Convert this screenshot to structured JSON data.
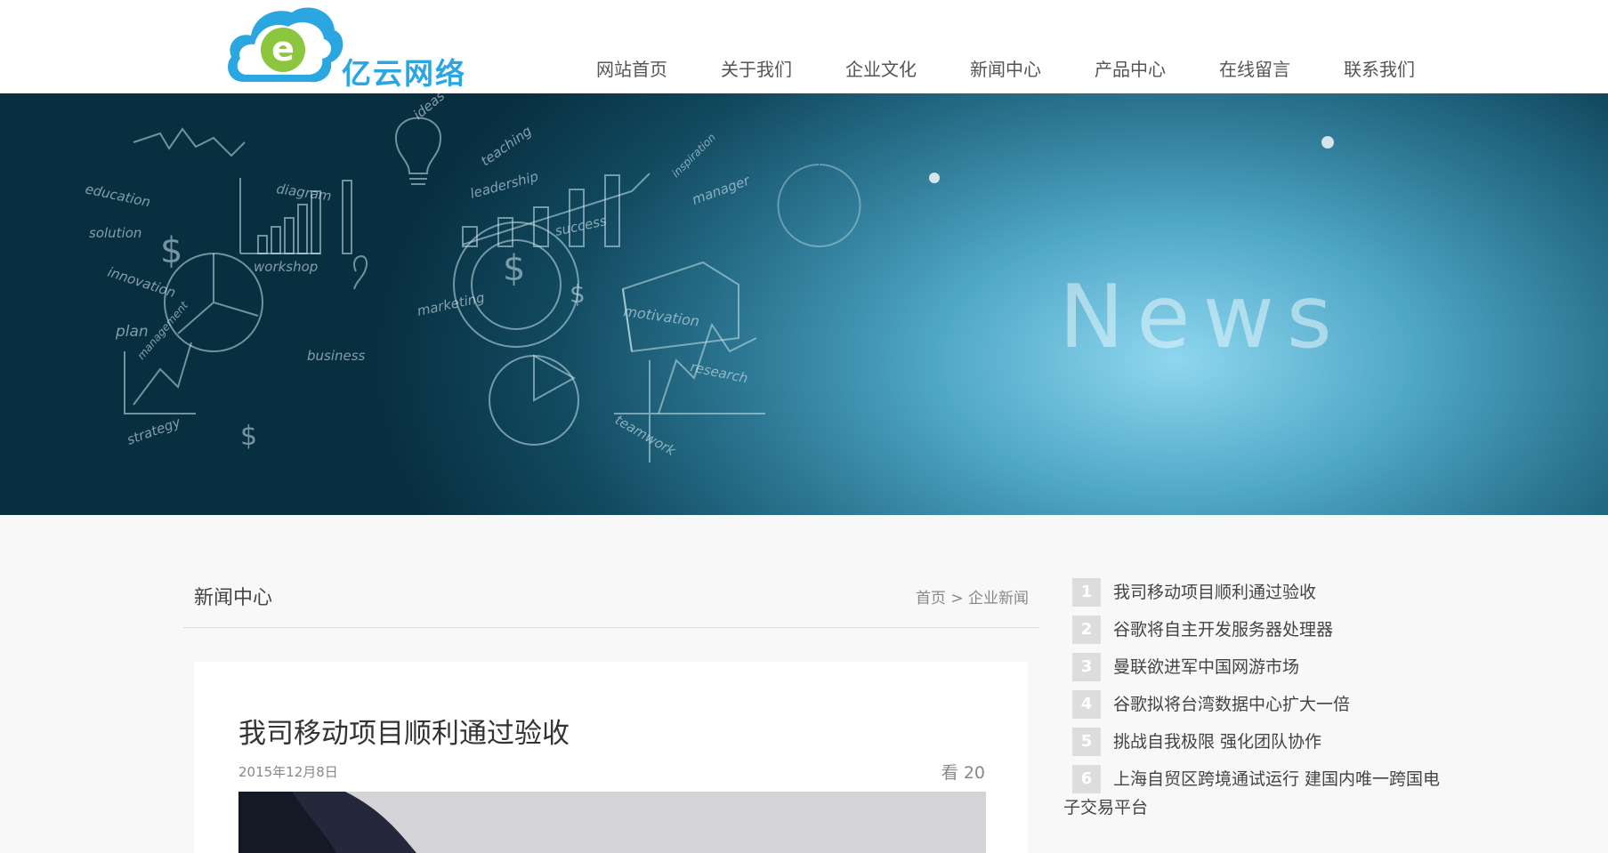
{
  "header": {
    "logo_text": "亿云网络",
    "logo_letter": "e",
    "nav": [
      "网站首页",
      "关于我们",
      "企业文化",
      "新闻中心",
      "产品中心",
      "在线留言",
      "联系我们"
    ]
  },
  "banner": {
    "word": "News",
    "sketch_words": [
      "education",
      "solution",
      "innovation",
      "plan",
      "diagram",
      "workshop",
      "ideas",
      "teaching",
      "leadership",
      "success",
      "marketing",
      "business",
      "management",
      "strategy",
      "motivation",
      "research",
      "teamwork",
      "manager",
      "inspiration"
    ]
  },
  "main": {
    "section_title": "新闻中心",
    "breadcrumb": {
      "home": "首页",
      "sep": " > ",
      "current": "企业新闻"
    },
    "article": {
      "title": "我司移动项目顺利通过验收",
      "date": "2015年12月8日",
      "views_label": "看",
      "views_count": "20"
    }
  },
  "sidebar": {
    "items": [
      {
        "num": "1",
        "title": "我司移动项目顺利通过验收"
      },
      {
        "num": "2",
        "title": "谷歌将自主开发服务器处理器"
      },
      {
        "num": "3",
        "title": "曼联欲进军中国网游市场"
      },
      {
        "num": "4",
        "title": "谷歌拟将台湾数据中心扩大一倍"
      },
      {
        "num": "5",
        "title": "挑战自我极限 强化团队协作"
      },
      {
        "num": "6",
        "title_line1": "上海自贸区跨境通试运行 建国内唯一跨国电",
        "title_line2": "子交易平台"
      }
    ]
  },
  "colors": {
    "brand": "#2aa6e0",
    "logo_green": "#8cc63f",
    "nav_text": "#555555",
    "badge": "#dddddd"
  }
}
